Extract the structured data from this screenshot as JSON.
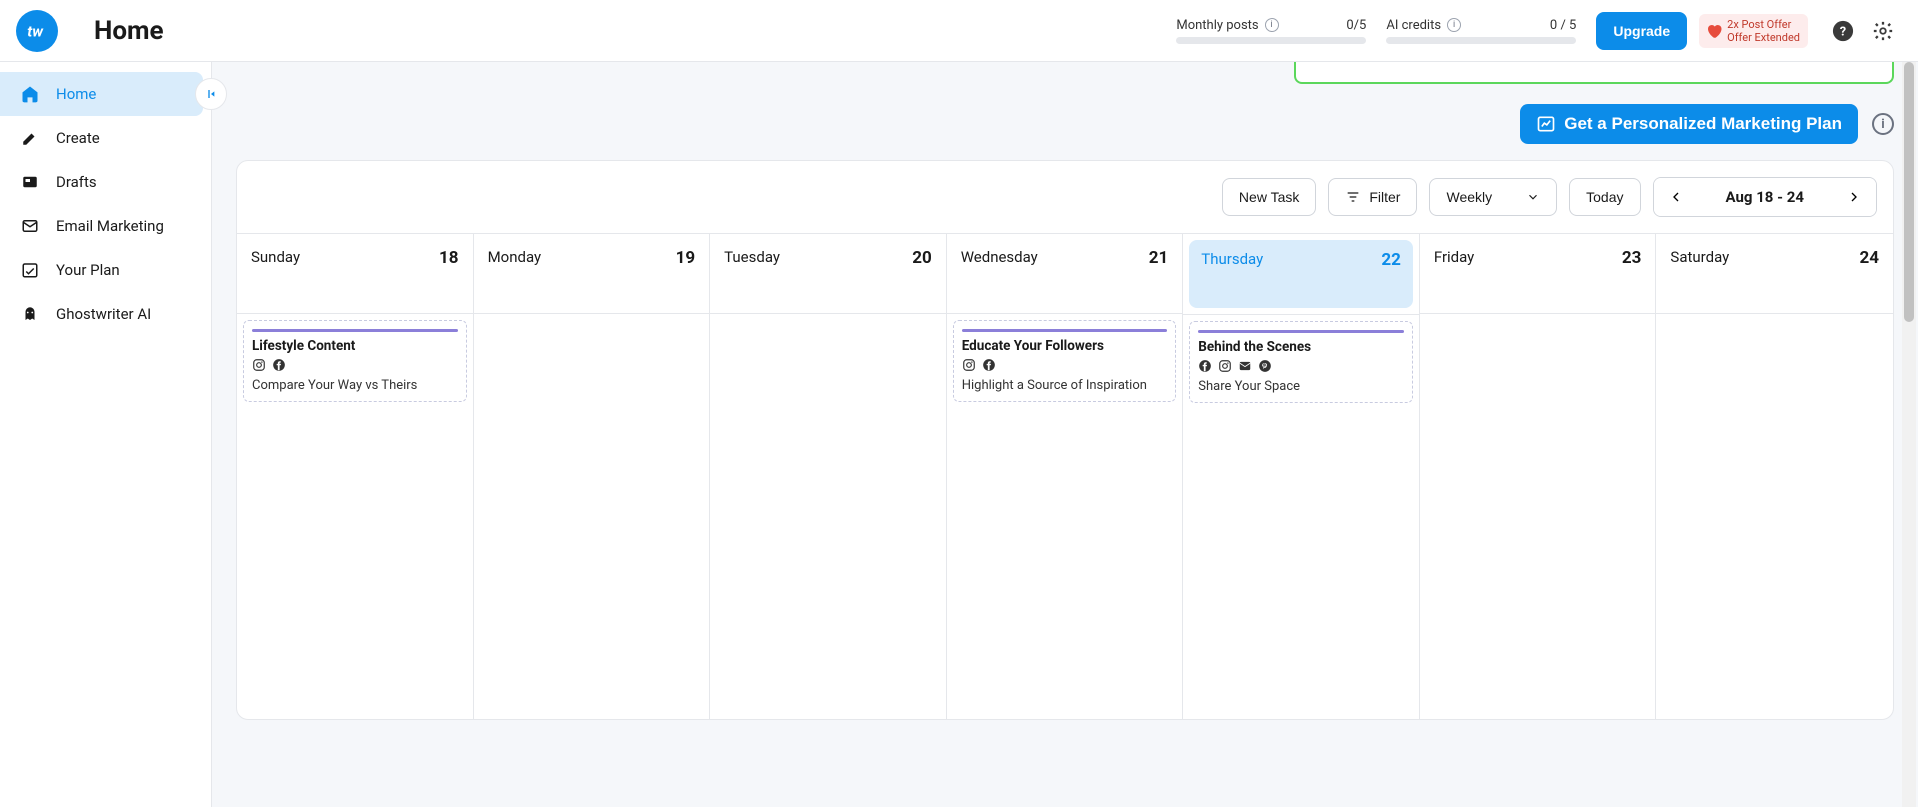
{
  "header": {
    "title": "Home",
    "monthly_posts_label": "Monthly posts",
    "monthly_posts_value": "0/5",
    "ai_credits_label": "AI credits",
    "ai_credits_value": "0 / 5",
    "upgrade_label": "Upgrade",
    "promo_line1": "2x Post Offer",
    "promo_line2": "Offer Extended"
  },
  "sidebar": {
    "items": [
      {
        "label": "Home"
      },
      {
        "label": "Create"
      },
      {
        "label": "Drafts"
      },
      {
        "label": "Email Marketing"
      },
      {
        "label": "Your Plan"
      },
      {
        "label": "Ghostwriter AI"
      }
    ]
  },
  "banner": {
    "plan_button": "Get a Personalized Marketing Plan"
  },
  "toolbar": {
    "new_task": "New Task",
    "filter": "Filter",
    "view": "Weekly",
    "today": "Today",
    "range": "Aug 18 - 24"
  },
  "calendar": {
    "days": [
      {
        "name": "Sunday",
        "num": "18"
      },
      {
        "name": "Monday",
        "num": "19"
      },
      {
        "name": "Tuesday",
        "num": "20"
      },
      {
        "name": "Wednesday",
        "num": "21"
      },
      {
        "name": "Thursday",
        "num": "22",
        "today": true
      },
      {
        "name": "Friday",
        "num": "23"
      },
      {
        "name": "Saturday",
        "num": "24"
      }
    ],
    "events": {
      "0": {
        "title": "Lifestyle Content",
        "desc": "Compare Your Way vs Theirs",
        "icons": [
          "instagram",
          "facebook"
        ]
      },
      "3": {
        "title": "Educate Your Followers",
        "desc": "Highlight a Source of Inspiration",
        "icons": [
          "instagram",
          "facebook"
        ]
      },
      "4": {
        "title": "Behind the Scenes",
        "desc": "Share Your Space",
        "icons": [
          "facebook",
          "instagram",
          "mail",
          "pinterest"
        ]
      }
    }
  }
}
